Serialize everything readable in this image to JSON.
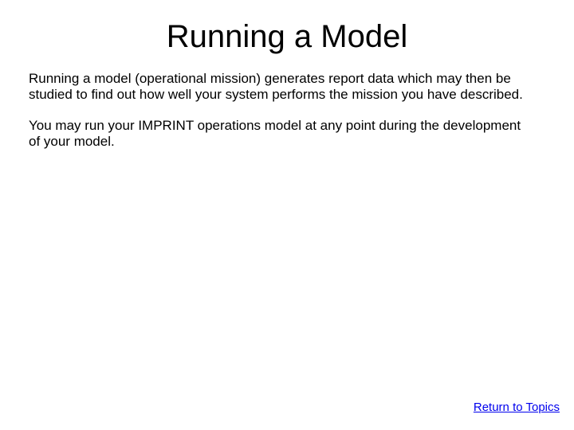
{
  "slide": {
    "title": "Running a Model",
    "paragraph1": "Running a model (operational mission) generates report data which may then be studied to find out how well your system performs the mission you have described.",
    "paragraph2": "You may run your IMPRINT operations model at any point during the development of your model.",
    "return_link": "Return to Topics"
  }
}
